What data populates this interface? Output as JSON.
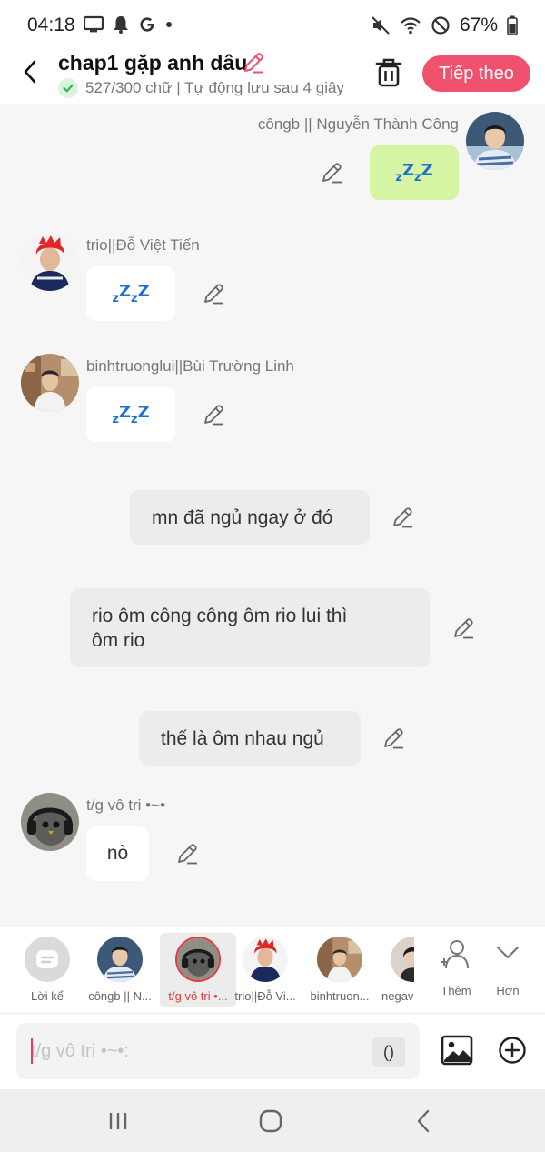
{
  "status": {
    "time": "04:18",
    "battery": "67%",
    "left_icons": [
      "monitor-icon",
      "bell-icon",
      "google-icon",
      "dot-icon"
    ],
    "right_icons": [
      "mute-icon",
      "wifi-icon",
      "do-not-disturb-icon",
      "battery-icon"
    ]
  },
  "header": {
    "title": "chap1 gặp anh dâu",
    "subtitle": "527/300 chữ | Tự động lưu sau 4 giây",
    "next_label": "Tiếp theo"
  },
  "messages": [
    {
      "speaker": "côngb || Nguyễn Thành Công",
      "content": "zZzZ",
      "side": "right"
    },
    {
      "speaker": "trio||Đỗ Việt Tiến",
      "content": "zZzZ",
      "side": "left"
    },
    {
      "speaker": "binhtruonglui||Bùi Trường Linh",
      "content": "zZzZ",
      "side": "left"
    },
    {
      "speaker": "",
      "content": "mn đã ngủ ngay ở đó",
      "side": "narration"
    },
    {
      "speaker": "",
      "content_line1": "rio ôm công công ôm rio lui thì",
      "content_line2": "ôm rio",
      "side": "narration"
    },
    {
      "speaker": "",
      "content": "thế là ôm nhau ngủ",
      "side": "narration"
    },
    {
      "speaker": "t/g vô tri •~•",
      "content": "nò",
      "side": "left"
    }
  ],
  "characters": [
    {
      "label": "Lời kể"
    },
    {
      "label": "côngb || N..."
    },
    {
      "label": "t/g vô tri •..."
    },
    {
      "label": "trio||Đỗ Vi..."
    },
    {
      "label": "binhtruon..."
    },
    {
      "label": "negav"
    }
  ],
  "more_actions": {
    "add_label": "Thêm",
    "more_label": "Hơn"
  },
  "input": {
    "placeholder": "t/g vô tri •~•:",
    "paren_label": "()"
  },
  "colors": {
    "accent": "#f0516d",
    "zzz": "#1e6fd0",
    "green_bubble": "#d5f5a4"
  }
}
